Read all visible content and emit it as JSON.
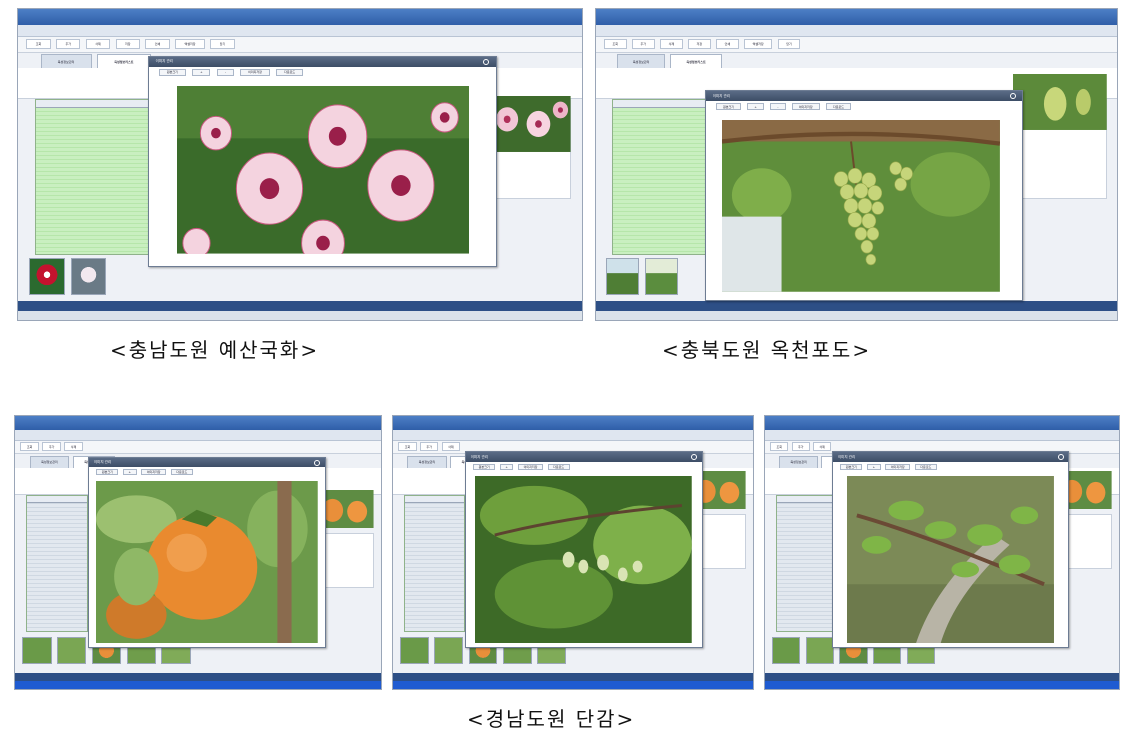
{
  "captions": {
    "chrysanthemum": "<충남도원 예산국화>",
    "grape": "<충북도원 옥천포도>",
    "persimmon": "<경남도원 단감>"
  },
  "app_chrome": {
    "tab_inactive": "육성정보관리",
    "tab_active": "육성정보리스트",
    "toolbar_buttons": [
      "조회",
      "추가",
      "삭제",
      "저장",
      "인쇄",
      "엑셀저장",
      "닫기"
    ],
    "dialog_title": "이미지 관리",
    "dialog_buttons": [
      "원본크기",
      "+",
      "-",
      "이미지저장",
      "다운로드"
    ]
  },
  "colors": {
    "grid_row": "#c9efc0",
    "title_bar": "#2f5ea8",
    "dialog_title": "#3d4d66",
    "taskbar": "#1f5bd1"
  },
  "icons": {
    "close": "close-icon"
  }
}
